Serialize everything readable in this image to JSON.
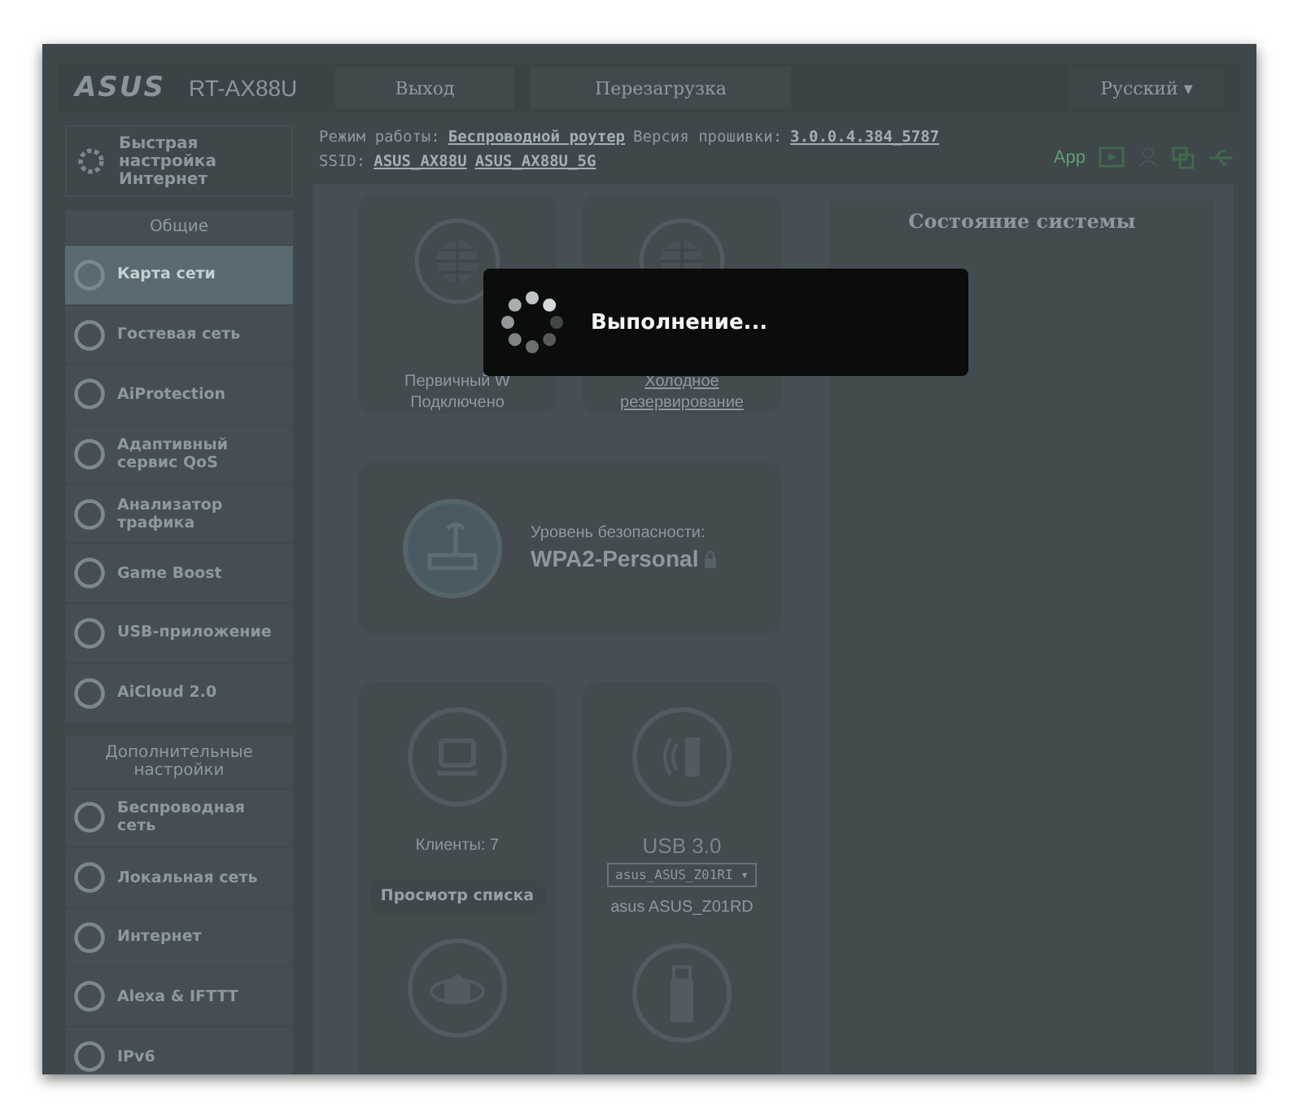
{
  "header": {
    "logo": "ASUS",
    "model": "RT-AX88U",
    "buttons": [
      "Выход",
      "Перезагрузка"
    ],
    "language": "Русский",
    "language_caret": "▾"
  },
  "info": {
    "mode_label": "Режим работы:",
    "mode": "Беспроводной роутер",
    "firmware_label": "Версия прошивки:",
    "firmware": "3.0.0.4.384_5787",
    "ssid_label": "SSID:",
    "ssids": [
      "ASUS_AX88U",
      "ASUS_AX88U_5G"
    ],
    "app": "App"
  },
  "sidebar": {
    "quick_setup": "Быстрая настройка Интернет",
    "sections": [
      {
        "title": "Общие",
        "items": [
          {
            "label": "Карта сети",
            "selected": true
          },
          {
            "label": "Гостевая сеть",
            "selected": false
          },
          {
            "label": "AiProtection",
            "selected": false
          },
          {
            "label": "Адаптивный сервис QoS",
            "selected": false
          },
          {
            "label": "Анализатор трафика",
            "selected": false
          },
          {
            "label": "Game Boost",
            "selected": false
          },
          {
            "label": "USB-приложение",
            "selected": false
          },
          {
            "label": "AiCloud 2.0",
            "selected": false
          }
        ]
      },
      {
        "title": "Дополнительные настройки",
        "items": [
          {
            "label": "Беспроводная сеть",
            "selected": false
          },
          {
            "label": "Локальная сеть",
            "selected": false
          },
          {
            "label": "Интернет",
            "selected": false
          },
          {
            "label": "Alexa & IFTTT",
            "selected": false
          },
          {
            "label": "IPv6",
            "selected": false
          }
        ]
      }
    ]
  },
  "network_map": {
    "wan": {
      "label": "Первичный W",
      "status": "Подключено"
    },
    "backup": {
      "label": "Холодное",
      "status": "резервирование"
    },
    "router": {
      "security_label": "Уровень безопасности:",
      "security": "WPA2-Personal"
    },
    "clients": {
      "label": "Клиенты:",
      "count": "7",
      "button": "Просмотр списка"
    },
    "usb": {
      "label": "USB 3.0",
      "device_select": "asus_ASUS_Z01RI ▾",
      "device": "asus ASUS_Z01RD"
    }
  },
  "status_panel": {
    "title": "Состояние системы"
  },
  "dialog": {
    "message": "Выполнение..."
  }
}
